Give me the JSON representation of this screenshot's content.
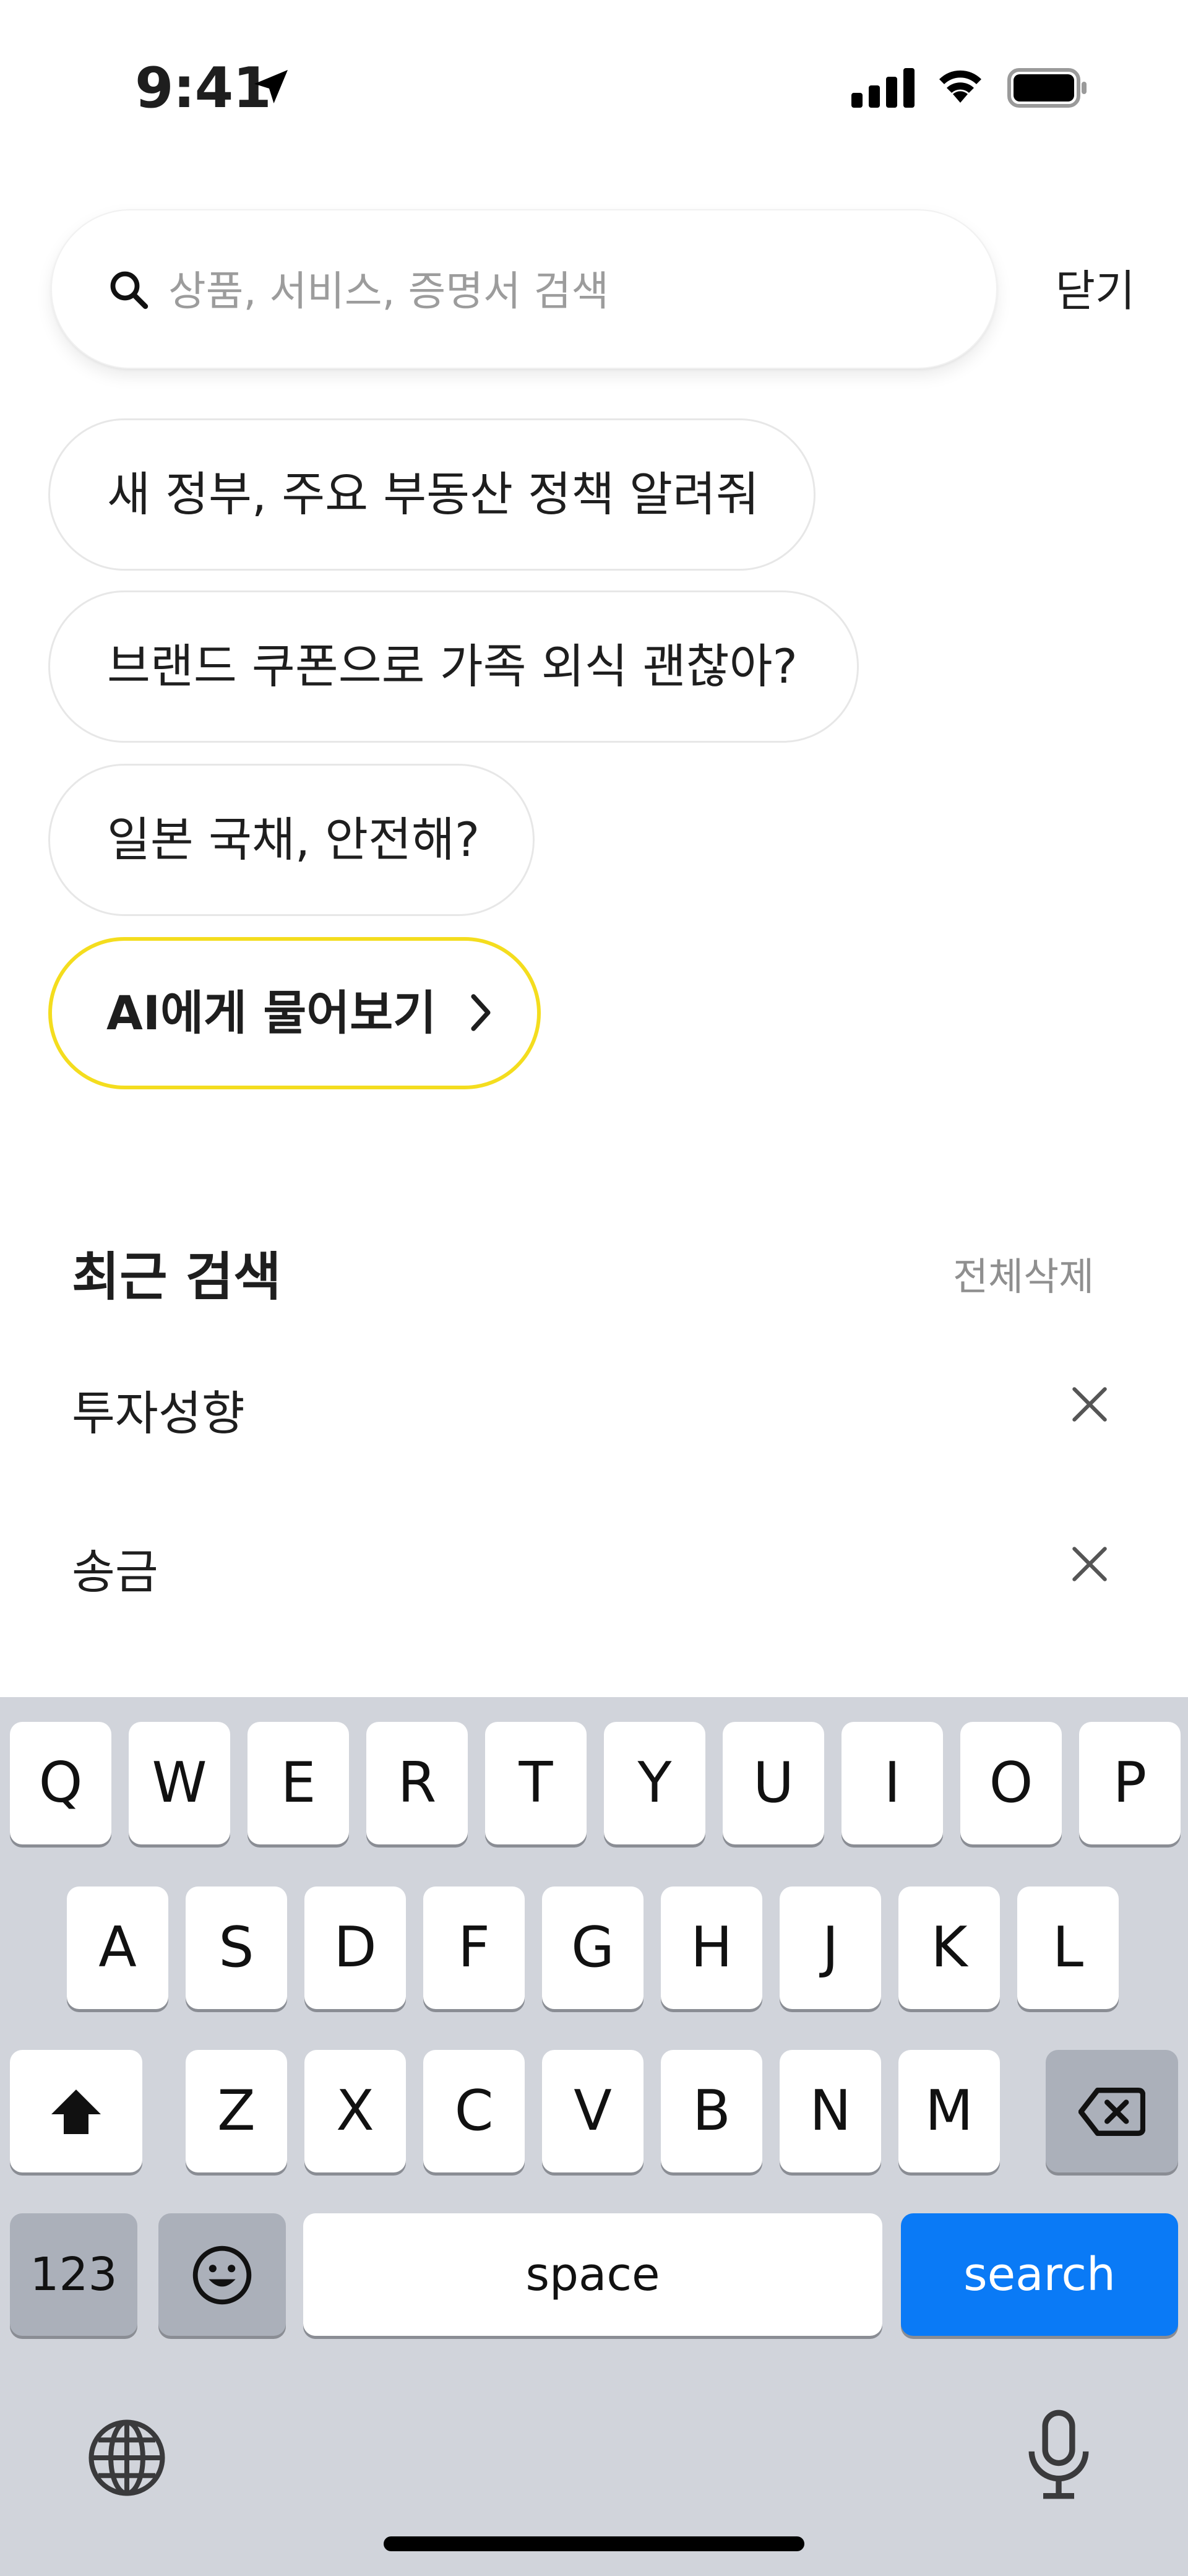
{
  "status_bar": {
    "time": "9:41"
  },
  "search": {
    "placeholder": "상품, 서비스, 증명서 검색",
    "close_label": "닫기"
  },
  "suggestions": [
    {
      "label": "새 정부, 주요 부동산 정책 알려줘"
    },
    {
      "label": "브랜드 쿠폰으로 가족 외식 괜찮아?"
    },
    {
      "label": "일본 국채, 안전해?"
    }
  ],
  "ai_button": {
    "label": "AI에게 물어보기",
    "border_color": "#f4dd1e"
  },
  "recent": {
    "title": "최근 검색",
    "delete_all": "전체삭제",
    "items": [
      {
        "label": "투자성향"
      },
      {
        "label": "송금"
      }
    ]
  },
  "keyboard": {
    "row1": [
      "Q",
      "W",
      "E",
      "R",
      "T",
      "Y",
      "U",
      "I",
      "O",
      "P"
    ],
    "row2": [
      "A",
      "S",
      "D",
      "F",
      "G",
      "H",
      "J",
      "K",
      "L"
    ],
    "row3": [
      "Z",
      "X",
      "C",
      "V",
      "B",
      "N",
      "M"
    ],
    "numbers_label": "123",
    "space_label": "space",
    "search_label": "search",
    "accent_color": "#0a7af6"
  },
  "icons": [
    "location-arrow-icon",
    "cellular-signal-icon",
    "wifi-icon",
    "battery-icon",
    "search-icon",
    "close-x-icon",
    "chevron-right-icon",
    "shift-icon",
    "backspace-icon",
    "emoji-icon",
    "globe-icon",
    "microphone-icon"
  ]
}
